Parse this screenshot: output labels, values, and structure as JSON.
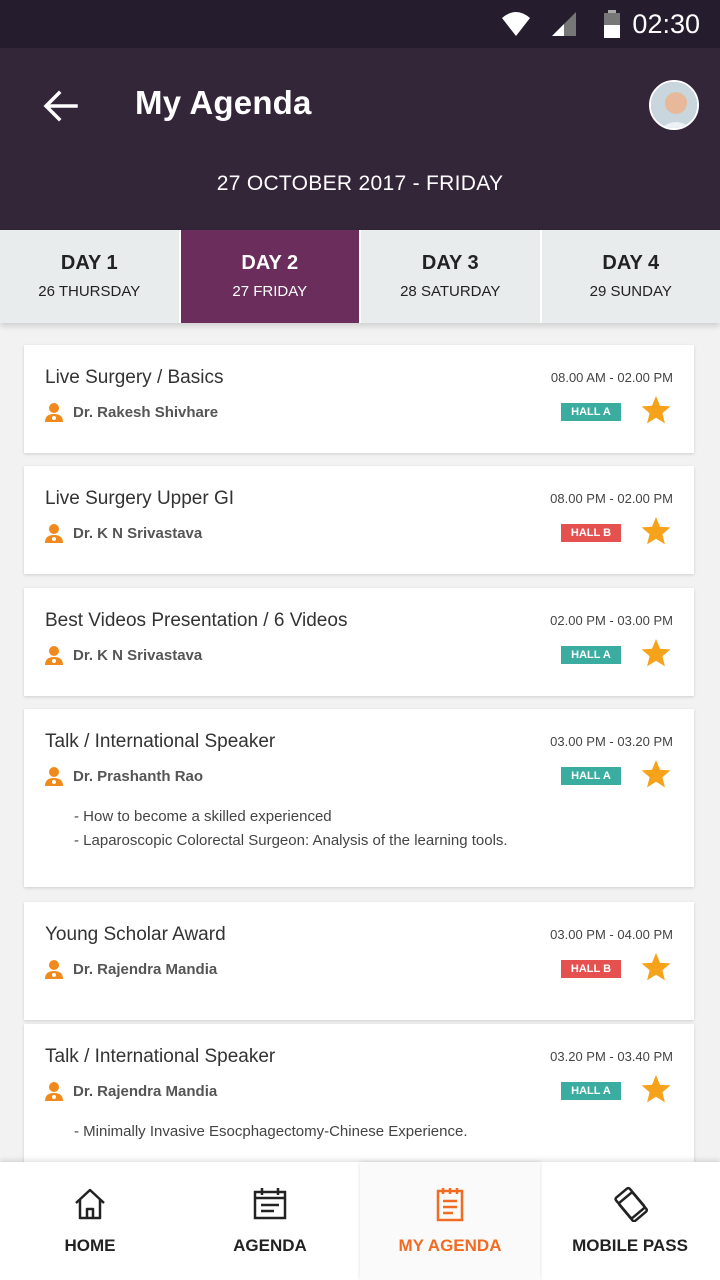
{
  "status": {
    "time": "02:30"
  },
  "header": {
    "title": "My Agenda",
    "date": "27 OCTOBER 2017 - FRIDAY"
  },
  "tabs": [
    {
      "day": "DAY 1",
      "sub": "26 THURSDAY"
    },
    {
      "day": "DAY 2",
      "sub": "27 FRIDAY"
    },
    {
      "day": "DAY 3",
      "sub": "28 SATURDAY"
    },
    {
      "day": "DAY 4",
      "sub": "29 SUNDAY"
    }
  ],
  "active_tab": "DAY 2",
  "sessions": [
    {
      "title": "Live Surgery / Basics",
      "time": "08.00 AM - 02.00 PM",
      "speaker": "Dr. Rakesh Shivhare",
      "hall": "HALL A",
      "hall_color": "#3aada0",
      "desc": []
    },
    {
      "title": "Live Surgery Upper GI",
      "time": "08.00 PM - 02.00 PM",
      "speaker": "Dr. K N Srivastava",
      "hall": "HALL B",
      "hall_color": "#e5514f",
      "desc": []
    },
    {
      "title": "Best Videos Presentation / 6 Videos",
      "time": "02.00 PM - 03.00 PM",
      "speaker": "Dr. K N Srivastava",
      "hall": "HALL A",
      "hall_color": "#3aada0",
      "desc": []
    },
    {
      "title": "Talk / International Speaker",
      "time": "03.00 PM - 03.20 PM",
      "speaker": "Dr. Prashanth Rao",
      "hall": "HALL A",
      "hall_color": "#3aada0",
      "desc": [
        "- How to become a skilled experienced",
        "- Laparoscopic Colorectal Surgeon: Analysis of the learning tools."
      ]
    },
    {
      "title": "Young Scholar Award",
      "time": "03.00 PM - 04.00 PM",
      "speaker": "Dr. Rajendra Mandia",
      "hall": "HALL B",
      "hall_color": "#e5514f",
      "desc": []
    },
    {
      "title": "Talk / International Speaker",
      "time": "03.20 PM - 03.40 PM",
      "speaker": "Dr. Rajendra Mandia",
      "hall": "HALL A",
      "hall_color": "#3aada0",
      "desc": [
        "- Minimally Invasive Esocphagectomy-Chinese Experience."
      ]
    }
  ],
  "nav": [
    {
      "label": "HOME",
      "icon": "home-icon"
    },
    {
      "label": "AGENDA",
      "icon": "agenda-icon"
    },
    {
      "label": "MY AGENDA",
      "icon": "my-agenda-icon"
    },
    {
      "label": "MOBILE PASS",
      "icon": "mobile-pass-icon"
    }
  ],
  "active_nav": "MY AGENDA",
  "colors": {
    "header": "#342639",
    "active_tab": "#6b2d5c",
    "accent": "#f26b22",
    "star": "#f7a21b"
  }
}
